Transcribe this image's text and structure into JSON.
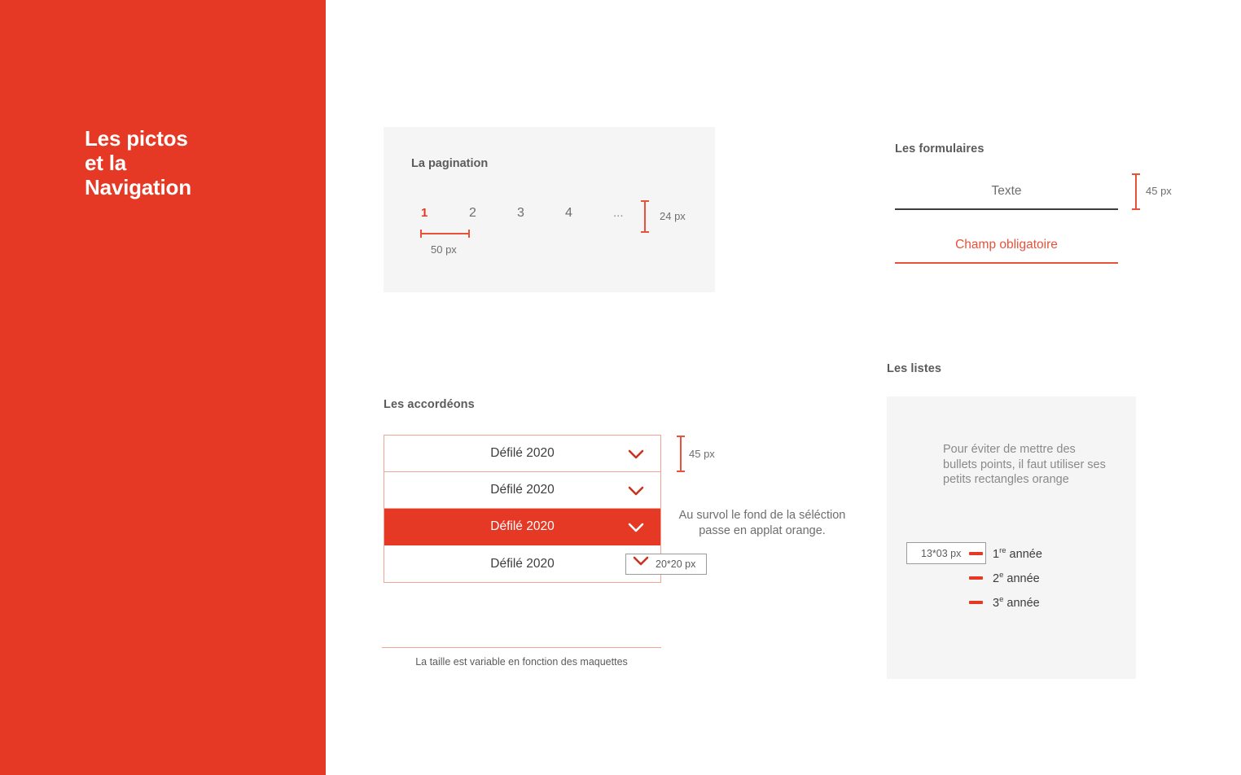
{
  "sidebar": {
    "title": "Les pictos\net la\nNavigation",
    "bg_color": "#E53925"
  },
  "pagination": {
    "title": "La pagination",
    "pages": [
      {
        "label": "1",
        "current": true
      },
      {
        "label": "2",
        "current": false
      },
      {
        "label": "3",
        "current": false
      },
      {
        "label": "4",
        "current": false
      },
      {
        "label": "...",
        "current": false
      }
    ],
    "measure_width_label": "50 px",
    "measure_height_label": "24 px"
  },
  "forms": {
    "heading": "Les formulaires",
    "text_field": {
      "label": "Texte",
      "placeholder": "Texte"
    },
    "required_field": {
      "label": "Champ obligatoire",
      "placeholder": "Champ obligatoire"
    },
    "measure_height_label": "45 px"
  },
  "accordions": {
    "heading": "Les accordéons",
    "rows": [
      {
        "label": "Défilé 2020",
        "active": false
      },
      {
        "label": "Défilé 2020",
        "active": false
      },
      {
        "label": "Défilé 2020",
        "active": true
      },
      {
        "label": "Défilé 2020",
        "active": false
      }
    ],
    "measure_height_label": "45 px",
    "hover_note": "Au survol le fond de la séléction passe en applat orange.",
    "icon_size_label": "20*20 px",
    "size_note": "La taille est variable en fonction des maquettes"
  },
  "lists": {
    "heading": "Les listes",
    "note": "Pour éviter de mettre des bullets points, il faut utiliser ses petits rectangles orange",
    "bullet_size_label": "13*03 px",
    "items": [
      {
        "number": "1",
        "ordinal": "re",
        "text": " année"
      },
      {
        "number": "2",
        "ordinal": "e",
        "text": " année"
      },
      {
        "number": "3",
        "ordinal": "e",
        "text": " année"
      }
    ]
  },
  "colors": {
    "brand_red": "#E53925",
    "accent_orange": "#E8513A",
    "panel_gray": "#F5F5F5",
    "text_gray": "#6e6e6e"
  }
}
